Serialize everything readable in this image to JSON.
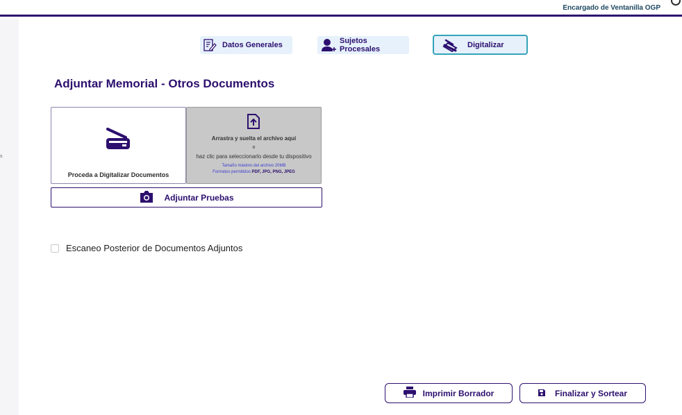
{
  "header": {
    "user_role": "Encargado de Ventanilla OGP"
  },
  "sidebar": {
    "fragment": "s"
  },
  "tabs": [
    {
      "label": "Datos Generales",
      "icon": "edit-document-icon"
    },
    {
      "label": "Sujetos Procesales",
      "icon": "add-person-icon"
    },
    {
      "label": "Digitalizar",
      "icon": "scanner-icon",
      "active": true
    }
  ],
  "section": {
    "title": "Adjuntar Memorial - Otros Documentos"
  },
  "scan_card": {
    "label": "Proceda a Digitalizar Documentos",
    "icon": "scanner-icon"
  },
  "drop_zone": {
    "icon": "file-upload-icon",
    "line1": "Arrastra y suelta el archivo aquí",
    "line2": "o",
    "line3": "haz clic para seleccionarlo desde tu dispositivo",
    "line4": "Tamaño máximo del archivo 20MB",
    "line5_prefix": "Formatos permitidos ",
    "line5_formats": "PDF, JPG, PNG, JPEG"
  },
  "attach_button": {
    "label": "Adjuntar Pruebas",
    "icon": "camera-icon"
  },
  "checkbox": {
    "label": "Escaneo Posterior de Documentos Adjuntos",
    "checked": false
  },
  "footer": {
    "print_label": "Imprimir Borrador",
    "finalize_label": "Finalizar y Sortear"
  },
  "colors": {
    "primary": "#2c0f6e",
    "active_tab_border": "#33a3b8",
    "tab_background": "#e6f1fb",
    "drop_zone_background": "#c8c8c8",
    "link_blue": "#3c3cd2"
  }
}
